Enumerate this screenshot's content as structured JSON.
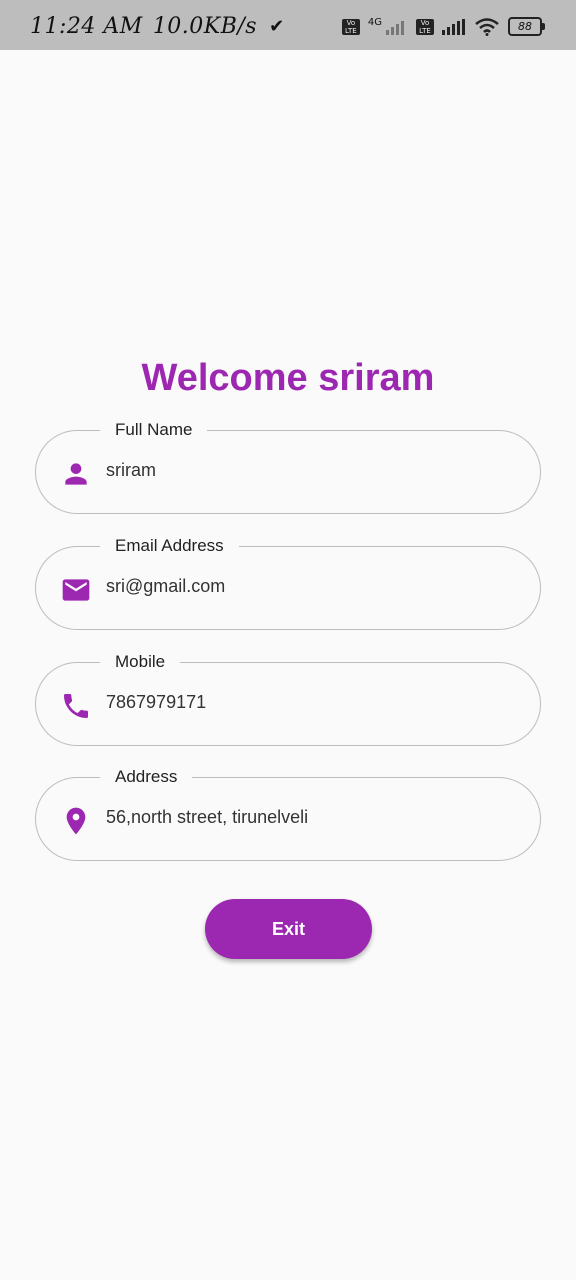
{
  "status_bar": {
    "time": "11:24 AM",
    "speed": "10.0KB/s",
    "volte_label": "Vo LTE",
    "network_label": "4G",
    "battery": "88"
  },
  "page": {
    "title": "Welcome sriram"
  },
  "fields": [
    {
      "label": "Full Name",
      "value": "sriram",
      "icon": "person-icon"
    },
    {
      "label": "Email Address",
      "value": "sri@gmail.com",
      "icon": "email-icon"
    },
    {
      "label": "Mobile",
      "value": "7867979171",
      "icon": "phone-icon"
    },
    {
      "label": "Address",
      "value": "56,north street, tirunelveli",
      "icon": "location-icon"
    }
  ],
  "actions": {
    "exit_label": "Exit"
  },
  "colors": {
    "accent": "#9c27b0",
    "background": "#fafafa",
    "status_bar": "#bdbdbd"
  }
}
